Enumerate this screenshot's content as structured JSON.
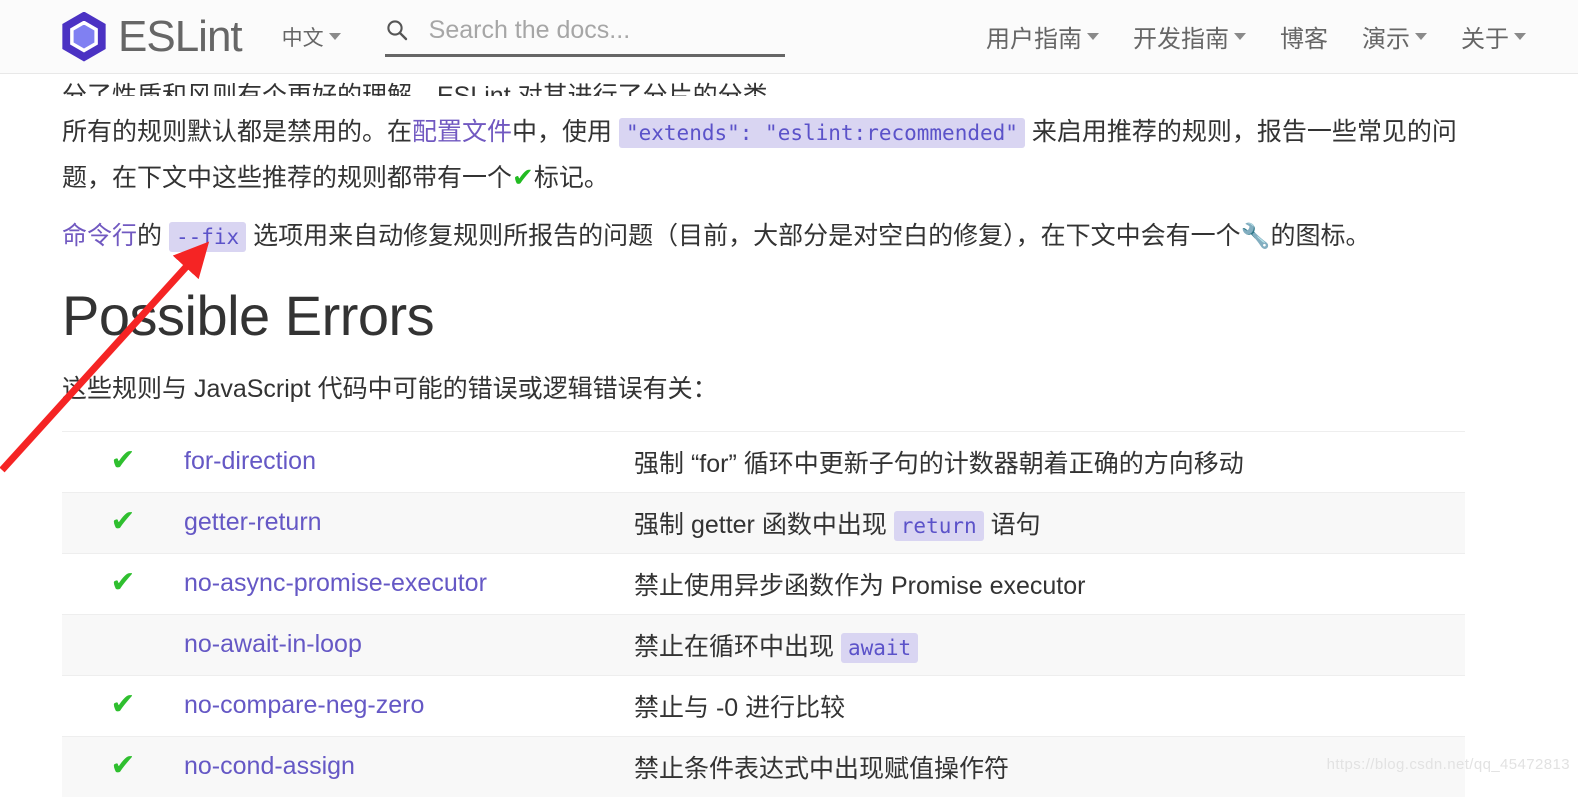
{
  "header": {
    "brand_name": "ESLint",
    "logo_icon": "eslint-hexagon-logo",
    "language": {
      "label": "中文",
      "caret": "▾"
    },
    "search": {
      "icon": "search-icon",
      "placeholder": "Search the docs...",
      "value": ""
    },
    "nav_items": [
      {
        "label": "用户指南",
        "has_dropdown": true
      },
      {
        "label": "开发指南",
        "has_dropdown": true
      },
      {
        "label": "博客",
        "has_dropdown": false
      },
      {
        "label": "演示",
        "has_dropdown": true
      },
      {
        "label": "关于",
        "has_dropdown": true
      }
    ]
  },
  "content": {
    "clipped_line": "分了性质和风则有个更好的理解，ESLint 对其进行了分片的分类。",
    "paragraph_recommended": {
      "part1": "所有的规则默认都是禁用的。在",
      "link1": "配置文件",
      "part2": "中，使用 ",
      "code": "\"extends\": \"eslint:recommended\"",
      "part3": " 来启用推荐的规则，报告一些常见的问题，在下文中这些推荐的规则都带有一个",
      "check_icon": "✔",
      "part4": "标记。"
    },
    "paragraph_fix": {
      "link1": "命令行",
      "part1": "的 ",
      "code": "--fix",
      "part2": " 选项用来自动修复规则所报告的问题（目前，大部分是对空白的修复），在下文中会有一个",
      "wrench_icon": "🔧",
      "part3": "的图标。"
    },
    "section_title": "Possible Errors",
    "section_desc": "这些规则与 JavaScript 代码中可能的错误或逻辑错误有关："
  },
  "rules_table": {
    "rows": [
      {
        "recommended": true,
        "name": "for-direction",
        "desc_pre": "强制 “for” 循环中更新子句的计数器朝着正确的方向移动",
        "code": "",
        "desc_post": ""
      },
      {
        "recommended": true,
        "name": "getter-return",
        "desc_pre": "强制 getter 函数中出现 ",
        "code": "return",
        "desc_post": " 语句"
      },
      {
        "recommended": true,
        "name": "no-async-promise-executor",
        "desc_pre": "禁止使用异步函数作为 Promise executor",
        "code": "",
        "desc_post": ""
      },
      {
        "recommended": false,
        "name": "no-await-in-loop",
        "desc_pre": "禁止在循环中出现 ",
        "code": "await",
        "desc_post": ""
      },
      {
        "recommended": true,
        "name": "no-compare-neg-zero",
        "desc_pre": "禁止与 -0 进行比较",
        "code": "",
        "desc_post": ""
      },
      {
        "recommended": true,
        "name": "no-cond-assign",
        "desc_pre": "禁止条件表达式中出现赋值操作符",
        "code": "",
        "desc_post": ""
      }
    ],
    "check_glyph": "✔"
  },
  "annotation": {
    "arrow_color": "#f52424",
    "type": "red-arrow-pointing-to-fix-code"
  },
  "watermark": {
    "text": "https://blog.csdn.net/qq_45472813"
  }
}
